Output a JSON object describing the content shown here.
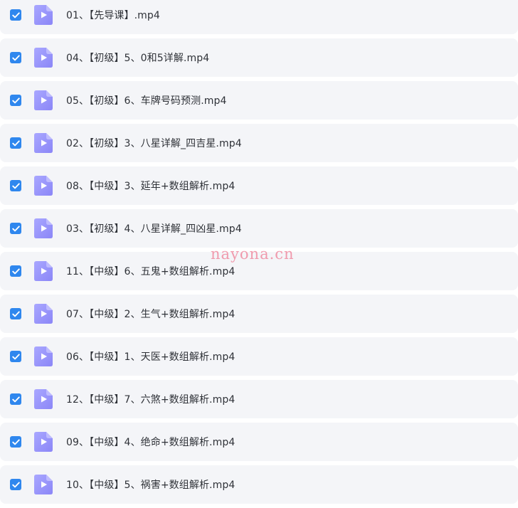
{
  "files": [
    {
      "name": "01、【先导课】.mp4",
      "checked": true,
      "icon": "video-file-icon"
    },
    {
      "name": "04、【初级】5、0和5详解.mp4",
      "checked": true,
      "icon": "video-file-icon"
    },
    {
      "name": "05、【初级】6、车牌号码预测.mp4",
      "checked": true,
      "icon": "video-file-icon"
    },
    {
      "name": "02、【初级】3、八星详解_四吉星.mp4",
      "checked": true,
      "icon": "video-file-icon"
    },
    {
      "name": "08、【中级】3、延年+数组解析.mp4",
      "checked": true,
      "icon": "video-file-icon"
    },
    {
      "name": "03、【初级】4、八星详解_四凶星.mp4",
      "checked": true,
      "icon": "video-file-icon"
    },
    {
      "name": "11、【中级】6、五鬼+数组解析.mp4",
      "checked": true,
      "icon": "video-file-icon"
    },
    {
      "name": "07、【中级】2、生气+数组解析.mp4",
      "checked": true,
      "icon": "video-file-icon"
    },
    {
      "name": "06、【中级】1、天医+数组解析.mp4",
      "checked": true,
      "icon": "video-file-icon"
    },
    {
      "name": "12、【中级】7、六煞+数组解析.mp4",
      "checked": true,
      "icon": "video-file-icon"
    },
    {
      "name": "09、【中级】4、绝命+数组解析.mp4",
      "checked": true,
      "icon": "video-file-icon"
    },
    {
      "name": "10、【中级】5、祸害+数组解析.mp4",
      "checked": true,
      "icon": "video-file-icon"
    }
  ],
  "watermark": "nayona.cn",
  "colors": {
    "checkbox": "#2f87ee",
    "icon_gradient_start": "#a9a7ff",
    "icon_gradient_end": "#8b86f7",
    "row_background": "#f4f5f8",
    "watermark": "#f08ba0"
  }
}
